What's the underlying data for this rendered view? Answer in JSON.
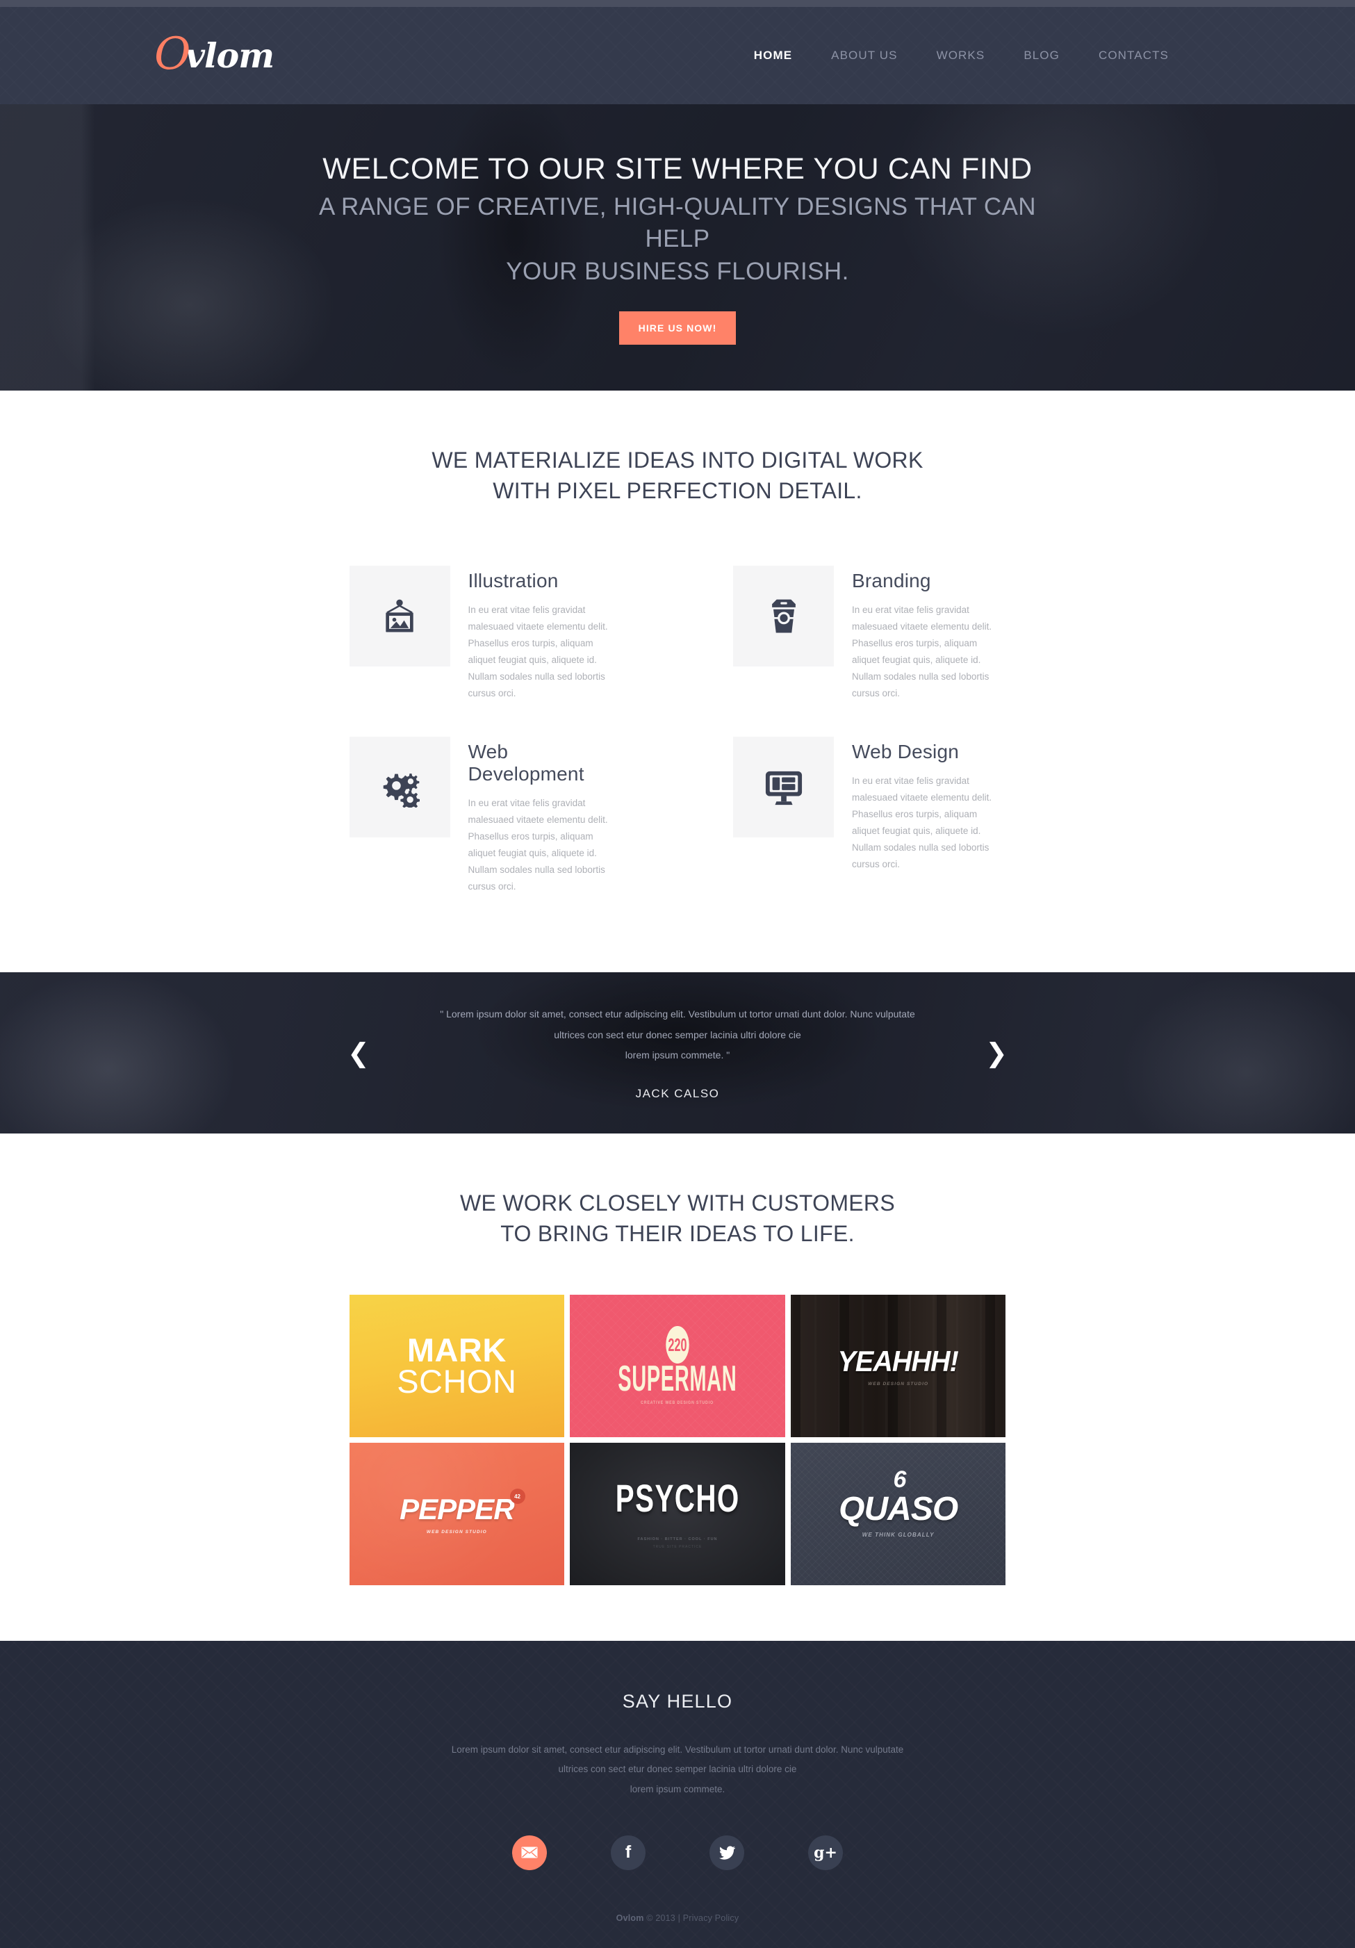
{
  "brand": {
    "logo_first": "O",
    "logo_rest": "vlom"
  },
  "nav": {
    "items": [
      {
        "label": "HOME",
        "active": true
      },
      {
        "label": "ABOUT US",
        "active": false
      },
      {
        "label": "WORKS",
        "active": false
      },
      {
        "label": "BLOG",
        "active": false
      },
      {
        "label": "CONTACTS",
        "active": false
      }
    ]
  },
  "hero": {
    "title": "WELCOME TO OUR SITE WHERE YOU CAN FIND",
    "subtitle_line1": "A RANGE OF CREATIVE, HIGH-QUALITY DESIGNS THAT CAN HELP",
    "subtitle_line2": "YOUR BUSINESS FLOURISH.",
    "cta_label": "HIRE US NOW!",
    "cta_color": "#ff8268"
  },
  "services": {
    "heading_line1": "WE MATERIALIZE IDEAS INTO DIGITAL WORK",
    "heading_line2": "WITH PIXEL PERFECTION DETAIL.",
    "body": "In eu erat vitae felis gravidat malesuaed vitaete elementu delit. Phasellus eros turpis, aliquam aliquet feugiat quis, aliquete id. Nullam sodales nulla sed lobortis cursus orci.",
    "items": [
      {
        "title": "Illustration",
        "icon": "picture-frame-icon"
      },
      {
        "title": "Branding",
        "icon": "coffee-cup-icon"
      },
      {
        "title": "Web Development",
        "icon": "gears-icon"
      },
      {
        "title": "Web Design",
        "icon": "monitor-layout-icon"
      }
    ]
  },
  "testimonial": {
    "quote_line1": "\" Lorem ipsum dolor sit amet, consect etur adipiscing elit. Vestibulum ut tortor urnati dunt dolor. Nunc vulputate",
    "quote_line2": "ultrices con sect etur donec semper lacinia ultri  dolore cie",
    "quote_line3": "lorem ipsum commete. \"",
    "author": "JACK CALSO",
    "prev_icon": "chevron-left-icon",
    "next_icon": "chevron-right-icon"
  },
  "portfolio": {
    "heading_line1": "WE WORK CLOSELY WITH CUSTOMERS",
    "heading_line2": "TO BRING THEIR IDEAS TO LIFE.",
    "items": [
      {
        "name": "mark-schon",
        "line1": "MARK",
        "line2": "SCHON",
        "sub": "",
        "color": "#f6c93f"
      },
      {
        "name": "superman",
        "badge": "220",
        "word": "SUPERMAN",
        "sub": "CREATIVE WEB DESIGN STUDIO",
        "color": "#f0596e"
      },
      {
        "name": "yeahhh",
        "word": "YEAHHH!",
        "sub": "WEB DESIGN STUDIO",
        "color": "#241d19"
      },
      {
        "name": "pepper",
        "word": "PEPPER",
        "badge": "42",
        "sub": "WEB DESIGN STUDIO",
        "color": "#ef6f53"
      },
      {
        "name": "psycho",
        "word": "PSYCHO",
        "sub": "FASHION · BITTER · COOL · FUN",
        "sub2": "TRUE SITE  PRACTICE",
        "color": "#2a2b30"
      },
      {
        "name": "quaso",
        "accent": "6",
        "word": "QUASO",
        "sub": "WE THINK GLOBALLY",
        "color": "#3a3f4d"
      }
    ]
  },
  "footer": {
    "heading": "SAY HELLO",
    "text_line1": "Lorem ipsum dolor sit amet, consect etur adipiscing elit. Vestibulum ut tortor urnati dunt dolor. Nunc vulputate",
    "text_line2": "ultrices con sect etur donec semper lacinia ultri  dolore cie",
    "text_line3": "lorem ipsum commete.",
    "socials": [
      {
        "name": "email",
        "icon": "envelope-icon"
      },
      {
        "name": "facebook",
        "icon": "facebook-icon",
        "glyph": "f"
      },
      {
        "name": "twitter",
        "icon": "twitter-icon"
      },
      {
        "name": "google-plus",
        "icon": "google-plus-icon",
        "glyph": "g+"
      }
    ],
    "copyright_brand": "Ovlom",
    "copyright_rest": " © 2013 | Privacy Policy"
  }
}
